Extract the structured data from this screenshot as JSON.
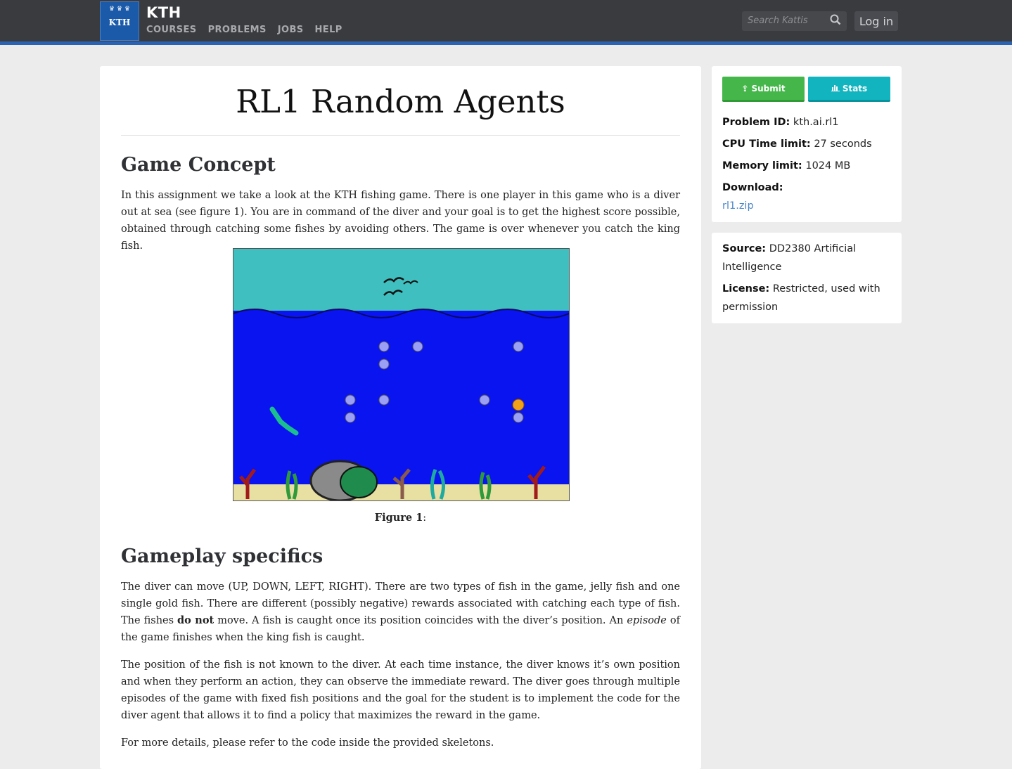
{
  "header": {
    "brand": "KTH",
    "logo_text": "KTH",
    "nav": [
      "COURSES",
      "PROBLEMS",
      "JOBS",
      "HELP"
    ],
    "search_placeholder": "Search Kattis",
    "login_label": "Log in"
  },
  "problem": {
    "title": "RL1 Random Agents",
    "sections": [
      {
        "heading": "Game Concept",
        "paragraphs": [
          "In this assignment we take a look at the KTH fishing game. There is one player in this game who is a diver out at sea (see figure 1). You are in command of the diver and your goal is to get the highest score possible, obtained through catching some fishes by avoiding others. The game is over whenever you catch the king fish."
        ]
      },
      {
        "heading": "Gameplay specifics",
        "p1_a": "The diver can move (UP, DOWN, LEFT, RIGHT). There are two types of fish in the game, jelly fish and one single gold fish. There are different (possibly negative) rewards associated with catching each type of fish. The fishes ",
        "p1_bold": "do not",
        "p1_b": " move. A fish is caught once its position coincides with the diver’s position. An ",
        "p1_italic": "episode",
        "p1_c": " of the game finishes when the king fish is caught.",
        "p2": "The position of the fish is not known to the diver. At each time instance, the diver knows it’s own position and when they perform an action, they can observe the immediate reward. The diver goes through multiple episodes of the game with fixed fish positions and the goal for the student is to implement the code for the diver agent that allows it to find a policy that maximizes the reward in the game.",
        "p3": "For more details, please refer to the code inside the provided skeletons."
      }
    ],
    "figure_caption_label": "Figure 1",
    "figure_caption_rest": ":"
  },
  "sidebar": {
    "submit_label": "Submit",
    "stats_label": "Stats",
    "problem_id_label": "Problem ID:",
    "problem_id": "kth.ai.rl1",
    "cpu_label": "CPU Time limit:",
    "cpu_value": "27 seconds",
    "memory_label": "Memory limit:",
    "memory_value": "1024 MB",
    "download_label": "Download:",
    "download_file": "rl1.zip",
    "source_label": "Source:",
    "source_value": "DD2380 Artificial Intelligence",
    "license_label": "License:",
    "license_value": "Restricted, used with permission"
  },
  "colors": {
    "topbar": "#3a3b3f",
    "accent_bar": "#2a63b4",
    "submit_green": "#45b649",
    "stats_teal": "#12b4bf",
    "link": "#4a86c6",
    "sky": "#3fbfbf",
    "sea": "#0a14f0"
  }
}
